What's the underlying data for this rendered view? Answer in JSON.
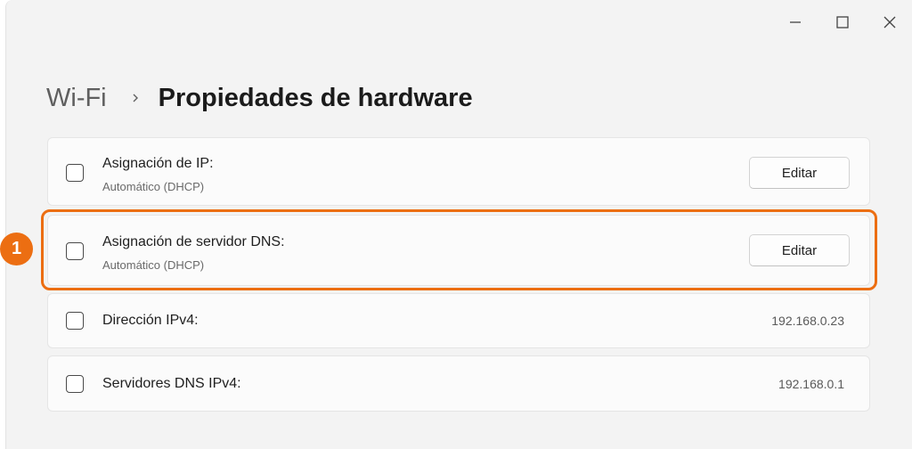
{
  "window": {
    "controls": {
      "minimize_icon": "minimize-icon",
      "maximize_icon": "maximize-icon",
      "close_icon": "close-icon"
    }
  },
  "breadcrumb": {
    "parent": "Wi-Fi",
    "separator_icon": "chevron-right-icon",
    "current": "Propiedades de hardware"
  },
  "rows": [
    {
      "title": "Asignación de IP:",
      "subtitle": "Automático (DHCP)",
      "action": "Editar"
    },
    {
      "title": "Asignación de servidor DNS:",
      "subtitle": "Automático (DHCP)",
      "action": "Editar"
    },
    {
      "title": "Dirección IPv4:",
      "value": "192.168.0.23"
    },
    {
      "title": "Servidores DNS IPv4:",
      "value": "192.168.0.1"
    }
  ],
  "annotation": {
    "marker": "1",
    "color": "#ec6e12"
  }
}
